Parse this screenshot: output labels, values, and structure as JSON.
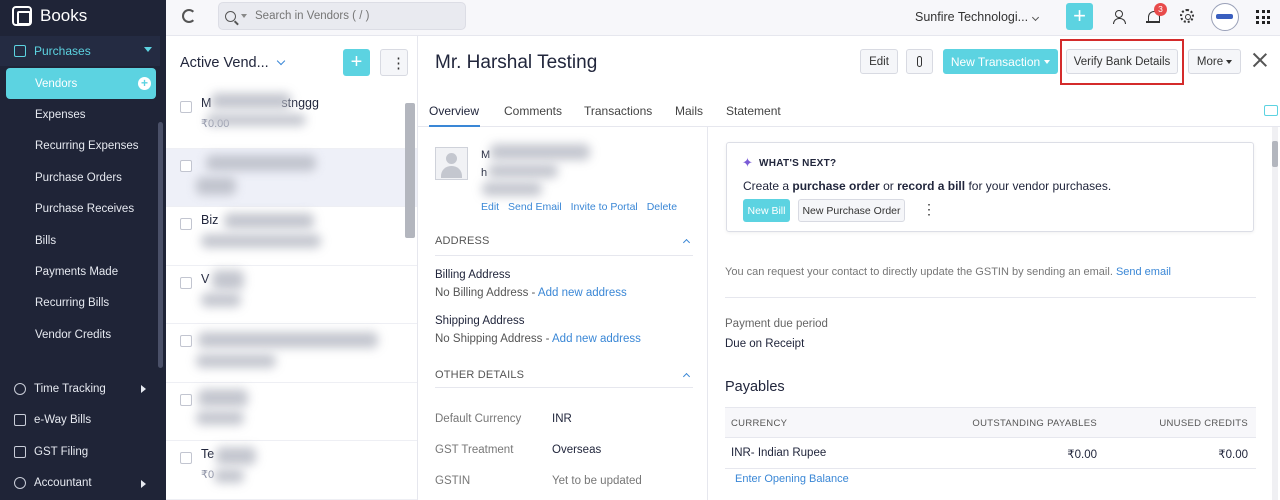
{
  "app": {
    "name": "Books"
  },
  "nav": {
    "section": "Purchases",
    "items": [
      {
        "label": "Vendors",
        "active": true
      },
      {
        "label": "Expenses"
      },
      {
        "label": "Recurring Expenses"
      },
      {
        "label": "Purchase Orders"
      },
      {
        "label": "Purchase Receives"
      },
      {
        "label": "Bills"
      },
      {
        "label": "Payments Made"
      },
      {
        "label": "Recurring Bills"
      },
      {
        "label": "Vendor Credits"
      }
    ],
    "bottom": [
      {
        "label": "Time Tracking",
        "icon": "clock-icon"
      },
      {
        "label": "e-Way Bills",
        "icon": "truck-icon"
      },
      {
        "label": "GST Filing",
        "icon": "document-icon"
      },
      {
        "label": "Accountant",
        "icon": "person-icon"
      }
    ]
  },
  "topbar": {
    "search_placeholder": "Search in Vendors ( / )",
    "org_name": "Sunfire Technologi...",
    "notification_count": "3"
  },
  "list": {
    "title": "Active Vend...",
    "rows": [
      {
        "name": "M",
        "name_tail": "stnggg",
        "amount": "₹0.00"
      },
      {
        "name": "",
        "amount": ""
      },
      {
        "name": "Biz",
        "amount": ""
      },
      {
        "name": "V",
        "amount": ""
      },
      {
        "name": "",
        "amount": ""
      },
      {
        "name": "",
        "amount": ""
      },
      {
        "name": "Te",
        "amount": "₹0"
      }
    ]
  },
  "detail": {
    "title": "Mr. Harshal Testing",
    "buttons": {
      "edit": "Edit",
      "new_transaction": "New Transaction",
      "verify_bank": "Verify Bank Details",
      "more": "More"
    },
    "tabs": [
      "Overview",
      "Comments",
      "Transactions",
      "Mails",
      "Statement"
    ],
    "contact": {
      "name_prefix": "M",
      "line2": "h",
      "links": [
        "Edit",
        "Send Email",
        "Invite to Portal",
        "Delete"
      ]
    },
    "address": {
      "heading": "ADDRESS",
      "billing_label": "Billing Address",
      "billing_value": "No Billing Address -",
      "billing_link": "Add new address",
      "shipping_label": "Shipping Address",
      "shipping_value": "No Shipping Address -",
      "shipping_link": "Add new address"
    },
    "other": {
      "heading": "OTHER DETAILS",
      "rows": [
        {
          "key": "Default Currency",
          "value": "INR"
        },
        {
          "key": "GST Treatment",
          "value": "Overseas"
        },
        {
          "key": "GSTIN",
          "value": "Yet to be updated"
        }
      ]
    },
    "whats_next": {
      "title": "WHAT'S NEXT?",
      "text_pre": "Create a ",
      "text_b1": "purchase order",
      "text_mid": " or ",
      "text_b2": "record a bill",
      "text_post": " for your vendor purchases.",
      "new_bill": "New Bill",
      "new_po": "New Purchase Order"
    },
    "gstin_note": "You can request your contact to directly update the GSTIN by sending an email.",
    "gstin_link": "Send email",
    "payment_due_label": "Payment due period",
    "payment_due_value": "Due on Receipt",
    "payables": {
      "title": "Payables",
      "headers": [
        "CURRENCY",
        "OUTSTANDING PAYABLES",
        "UNUSED CREDITS"
      ],
      "row": {
        "currency": "INR- Indian Rupee",
        "outstanding": "₹0.00",
        "unused": "₹0.00"
      },
      "opening_link": "Enter Opening Balance"
    }
  },
  "colors": {
    "accent": "#5cd3e1",
    "link": "#3a87d6",
    "sidebar": "#1f2437",
    "highlight": "#d42b2b"
  }
}
